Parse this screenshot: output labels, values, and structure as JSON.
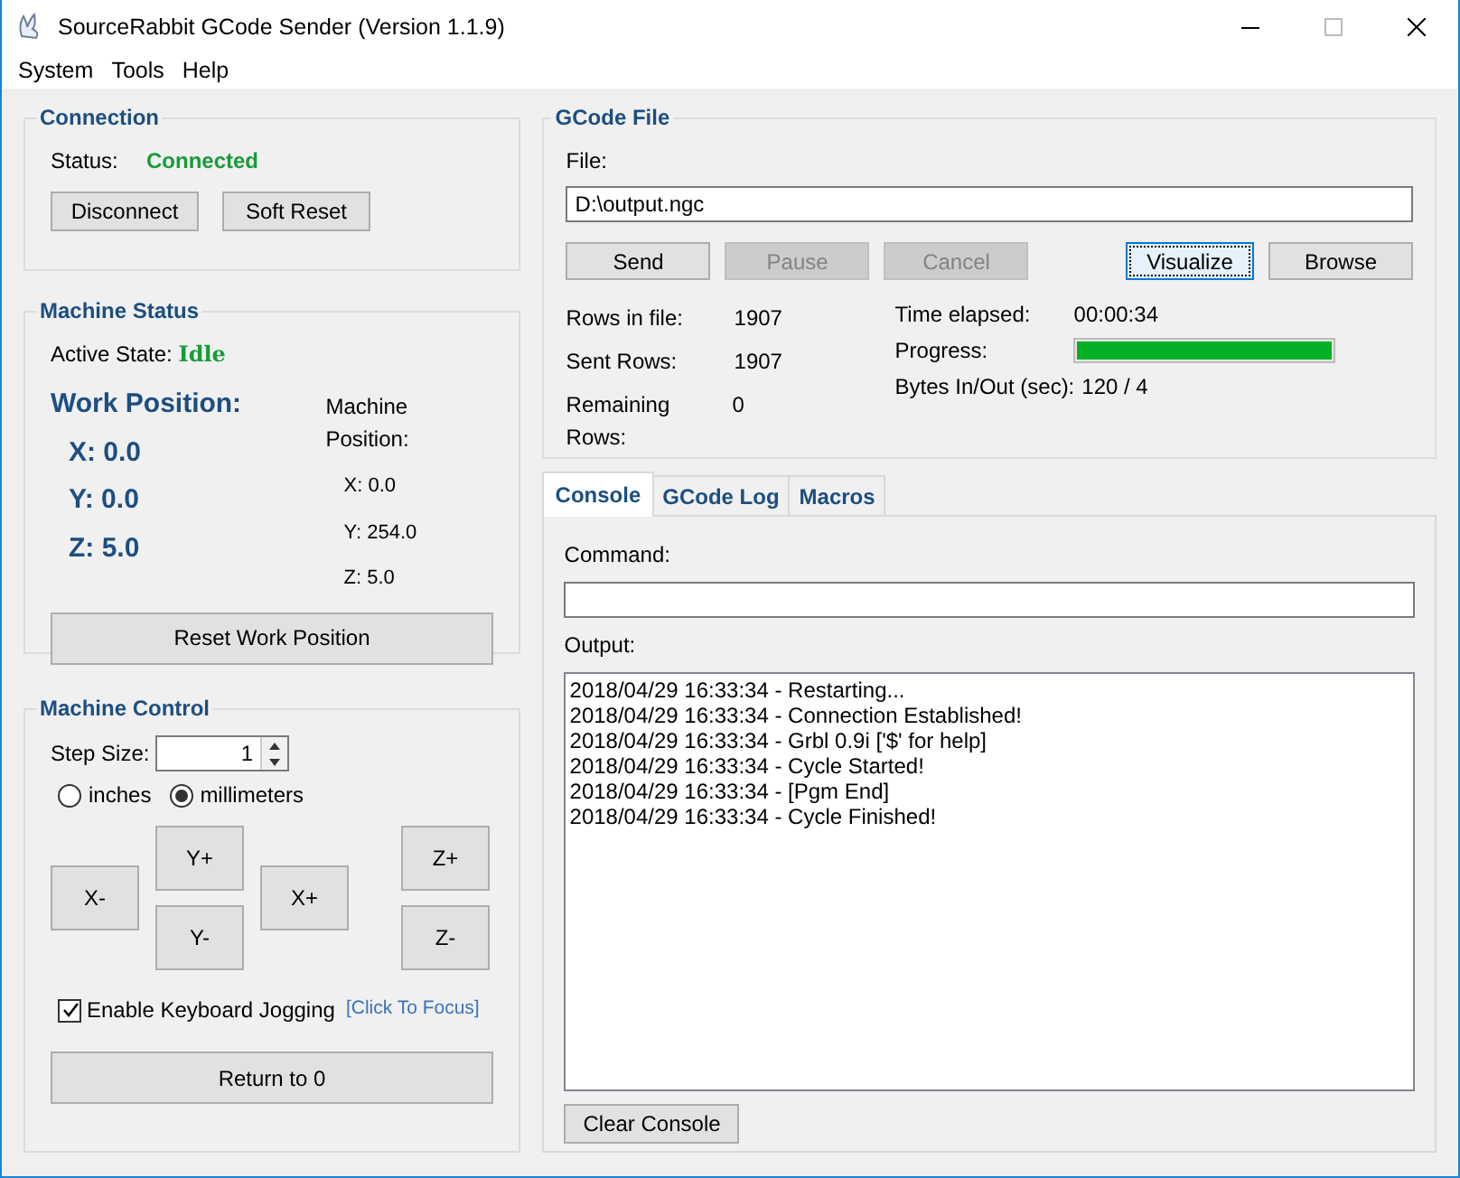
{
  "window": {
    "title": "SourceRabbit GCode Sender (Version 1.1.9)"
  },
  "menu": [
    "System",
    "Tools",
    "Help"
  ],
  "connection": {
    "title": "Connection",
    "status_label": "Status:",
    "status": "Connected",
    "buttons": [
      {
        "label": "Disconnect"
      },
      {
        "label": "Soft Reset"
      }
    ]
  },
  "machine_status": {
    "title": "Machine Status",
    "active_state_label": "Active State:",
    "active_state": "Idle",
    "work_position_label": "Work Position:",
    "work_position": [
      "X: 0.0",
      "Y: 0.0",
      "Z: 5.0"
    ],
    "machine_position_label": "Machine Position:",
    "machine_position": [
      "X: 0.0",
      "Y: 254.0",
      "Z: 5.0"
    ],
    "reset_button": "Reset Work Position"
  },
  "machine_control": {
    "title": "Machine Control",
    "step_size_label": "Step Size:",
    "step_size": "1",
    "units": [
      {
        "label": "inches",
        "selected": false
      },
      {
        "label": "millimeters",
        "selected": true
      }
    ],
    "jog": {
      "x_minus": "X-",
      "y_plus": "Y+",
      "y_minus": "Y-",
      "x_plus": "X+",
      "z_plus": "Z+",
      "z_minus": "Z-"
    },
    "keyboard_jogging": {
      "label": "Enable Keyboard Jogging",
      "checked": true
    },
    "focus_link": "[Click To Focus]",
    "return_button": "Return to 0"
  },
  "gcode_file": {
    "title": "GCode File",
    "file_label": "File:",
    "file": "D:\\output.ngc",
    "buttons": [
      {
        "label": "Send",
        "disabled": false,
        "focused": false
      },
      {
        "label": "Pause",
        "disabled": true,
        "focused": false
      },
      {
        "label": "Cancel",
        "disabled": true,
        "focused": false
      },
      {
        "label": "Visualize",
        "disabled": false,
        "focused": true
      },
      {
        "label": "Browse",
        "disabled": false,
        "focused": false
      }
    ],
    "stats_left": [
      {
        "label": "Rows in file:",
        "value": "1907"
      },
      {
        "label": "Sent Rows:",
        "value": "1907"
      },
      {
        "label": "Remaining Rows:",
        "value": "0"
      }
    ],
    "stats_right": [
      {
        "kind": "text",
        "label": "Time elapsed:",
        "value": "00:00:34"
      },
      {
        "kind": "progress",
        "label": "Progress:",
        "level": 1.0
      },
      {
        "kind": "text",
        "label": "Bytes In/Out (sec):",
        "value": "120 / 4"
      }
    ]
  },
  "tabs": [
    {
      "label": "Console",
      "selected": true
    },
    {
      "label": "GCode Log",
      "selected": false
    },
    {
      "label": "Macros",
      "selected": false
    }
  ],
  "console": {
    "command_label": "Command:",
    "output_label": "Output:",
    "output": [
      "2018/04/29 16:33:34 - Restarting...",
      "2018/04/29 16:33:34 - Connection Established!",
      "2018/04/29 16:33:34 - Grbl 0.9i ['$' for help]",
      "2018/04/29 16:33:34 - Cycle Started!",
      "2018/04/29 16:33:34 - [Pgm End]",
      "2018/04/29 16:33:34 - Cycle Finished!"
    ],
    "clear_button": "Clear Console"
  }
}
